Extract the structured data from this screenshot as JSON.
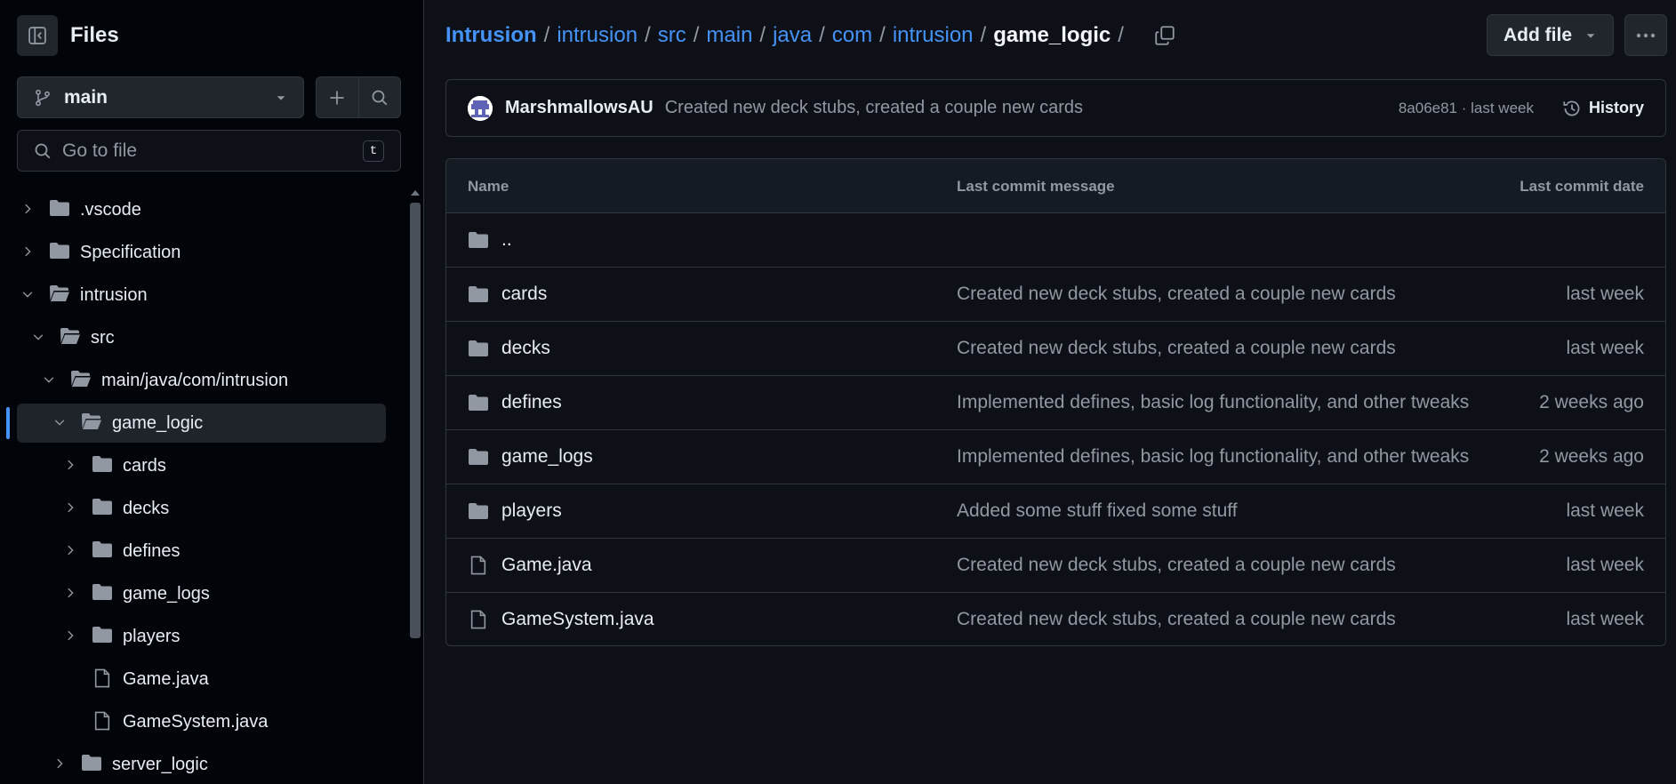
{
  "sidebar": {
    "title": "Files",
    "branch": "main",
    "goto_placeholder": "Go to file",
    "goto_shortcut": "t",
    "tree": [
      {
        "label": ".vscode",
        "kind": "folder",
        "expanded": false
      },
      {
        "label": "Specification",
        "kind": "folder",
        "expanded": false
      },
      {
        "label": "intrusion",
        "kind": "folder",
        "expanded": true
      },
      {
        "label": "src",
        "kind": "folder",
        "expanded": true
      },
      {
        "label": "main/java/com/intrusion",
        "kind": "folder",
        "expanded": true
      },
      {
        "label": "game_logic",
        "kind": "folder",
        "expanded": true,
        "active": true
      },
      {
        "label": "cards",
        "kind": "folder",
        "expanded": false
      },
      {
        "label": "decks",
        "kind": "folder",
        "expanded": false
      },
      {
        "label": "defines",
        "kind": "folder",
        "expanded": false
      },
      {
        "label": "game_logs",
        "kind": "folder",
        "expanded": false
      },
      {
        "label": "players",
        "kind": "folder",
        "expanded": false
      },
      {
        "label": "Game.java",
        "kind": "file"
      },
      {
        "label": "GameSystem.java",
        "kind": "file"
      },
      {
        "label": "server_logic",
        "kind": "folder",
        "expanded": false
      }
    ]
  },
  "breadcrumb": {
    "parts": [
      "Intrusion",
      "intrusion",
      "src",
      "main",
      "java",
      "com",
      "intrusion"
    ],
    "current": "game_logic",
    "trailing_sep": "/"
  },
  "toolbar": {
    "add_file_label": "Add file"
  },
  "commit": {
    "author": "MarshmallowsAU",
    "message": "Created new deck stubs, created a couple new cards",
    "meta": "8a06e81 · last week",
    "history_label": "History"
  },
  "table": {
    "headers": {
      "name": "Name",
      "message": "Last commit message",
      "date": "Last commit date"
    },
    "parent_label": "..",
    "rows": [
      {
        "name": "cards",
        "kind": "folder",
        "message": "Created new deck stubs, created a couple new cards",
        "date": "last week"
      },
      {
        "name": "decks",
        "kind": "folder",
        "message": "Created new deck stubs, created a couple new cards",
        "date": "last week"
      },
      {
        "name": "defines",
        "kind": "folder",
        "message": "Implemented defines, basic log functionality, and other tweaks",
        "date": "2 weeks ago"
      },
      {
        "name": "game_logs",
        "kind": "folder",
        "message": "Implemented defines, basic log functionality, and other tweaks",
        "date": "2 weeks ago"
      },
      {
        "name": "players",
        "kind": "folder",
        "message": "Added some stuff fixed some stuff",
        "date": "last week"
      },
      {
        "name": "Game.java",
        "kind": "file",
        "message": "Created new deck stubs, created a couple new cards",
        "date": "last week"
      },
      {
        "name": "GameSystem.java",
        "kind": "file",
        "message": "Created new deck stubs, created a couple new cards",
        "date": "last week"
      }
    ]
  },
  "colors": {
    "background": "#0d1117",
    "sidebar_background": "#010409",
    "link": "#4493f8",
    "muted_text": "#9198a1",
    "border": "#30363d",
    "folder_icon": "#9198a1"
  },
  "icons": {
    "sidebar_toggle": "sidebar-collapse-icon",
    "branch": "git-branch-icon",
    "add": "plus-icon",
    "search": "search-icon",
    "copy": "copy-icon",
    "more": "kebab-horizontal-icon",
    "history": "history-icon",
    "folder": "folder-icon",
    "file": "file-icon"
  }
}
